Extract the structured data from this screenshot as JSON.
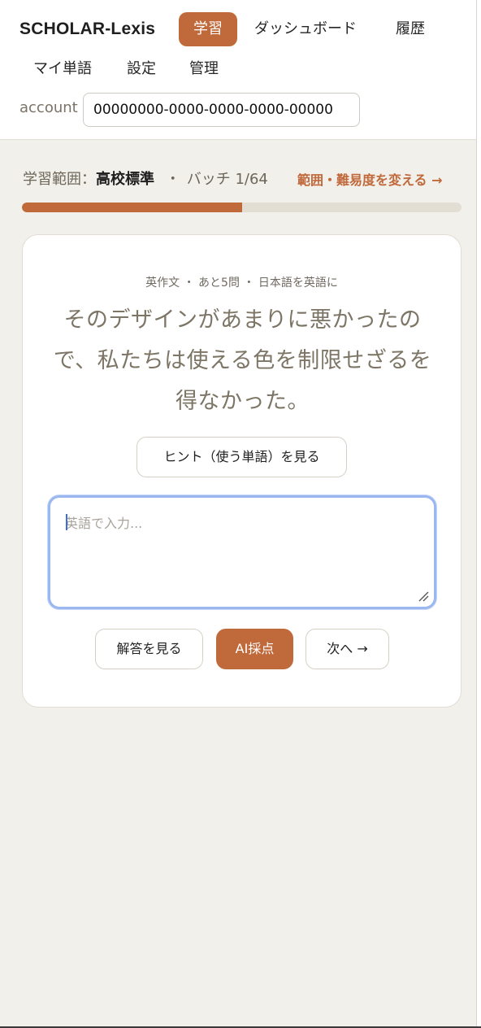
{
  "app": {
    "brand": "SCHOLAR-Lexis"
  },
  "nav": {
    "active": "学習",
    "items": [
      "ダッシュボード",
      "履歴",
      "マイ単語",
      "設定",
      "管理"
    ]
  },
  "account": {
    "label": "account",
    "value": "00000000-0000-0000-0000-00000"
  },
  "scope": {
    "prefix": "学習範囲：",
    "level": "高校標準",
    "separator": "・",
    "batch": "バッチ 1/64",
    "change_link": "範囲・難易度を変える →"
  },
  "progress": {
    "fraction": 0.5
  },
  "card": {
    "meta": "英作文 ・ あと5問 ・ 日本語を英語に",
    "prompt": "そのデザインがあまりに悪かったので、私たちは使える色を制限せざるを得なかった。",
    "hint_button": "ヒント（使う単語）を見る",
    "answer_placeholder": "英語で入力...",
    "buttons": {
      "show_answer": "解答を見る",
      "ai_grade": "AI採点",
      "next": "次へ →"
    }
  },
  "colors": {
    "accent": "#c0693a",
    "background": "#f2f0eb",
    "focus_ring": "#9bb7f0"
  }
}
